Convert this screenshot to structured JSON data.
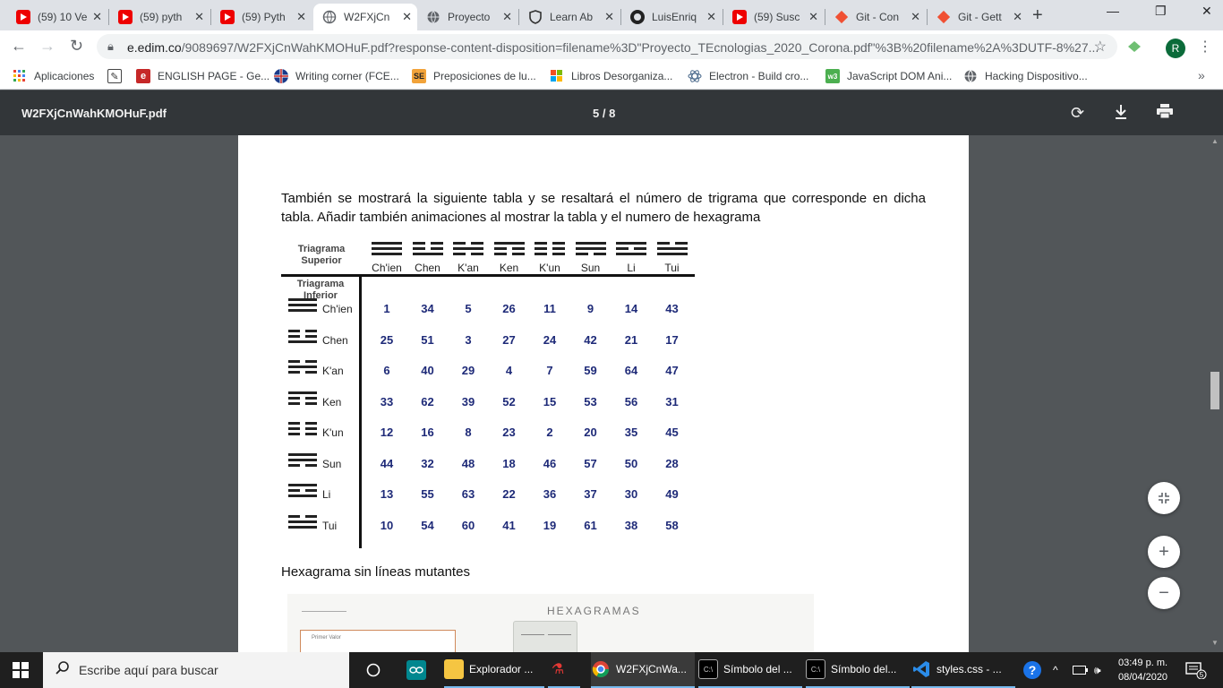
{
  "browser": {
    "tabs": [
      {
        "title": "(59) 10 Ve",
        "icon": "youtube-icon",
        "active": false
      },
      {
        "title": "(59) pyth",
        "icon": "youtube-icon",
        "active": false
      },
      {
        "title": "(59) Pyth",
        "icon": "youtube-icon",
        "active": false
      },
      {
        "title": "W2FXjCn",
        "icon": "globe-icon",
        "active": true
      },
      {
        "title": "Proyecto",
        "icon": "globe-icon",
        "active": false
      },
      {
        "title": "Learn Ab",
        "icon": "shield-icon",
        "active": false
      },
      {
        "title": "LuisEnriq",
        "icon": "github-icon",
        "active": false
      },
      {
        "title": "(59) Susc",
        "icon": "youtube-icon",
        "active": false
      },
      {
        "title": "Git - Con",
        "icon": "git-icon",
        "active": false
      },
      {
        "title": "Git - Gett",
        "icon": "git-icon",
        "active": false
      }
    ],
    "url_host": "e.edim.co",
    "url_path": "/9089697/W2FXjCnWahKMOHuF.pdf?response-content-disposition=filename%3D\"Proyecto_TEcnologias_2020_Corona.pdf\"%3B%20filename%2A%3DUTF-8%27...",
    "profile_initial": "R",
    "bookmarks": [
      {
        "label": "Aplicaciones",
        "icon": "apps-grid-icon"
      },
      {
        "label": "",
        "icon": "bookmark-favicon-icon"
      },
      {
        "label": "ENGLISH PAGE - Ge...",
        "icon": "english-page-icon"
      },
      {
        "label": "Writing corner (FCE...",
        "icon": "uk-flag-icon"
      },
      {
        "label": "Preposiciones de lu...",
        "icon": "se-icon"
      },
      {
        "label": "Libros Desorganiza...",
        "icon": "windows-logo-icon"
      },
      {
        "label": "Electron - Build cro...",
        "icon": "electron-icon"
      },
      {
        "label": "JavaScript DOM Ani...",
        "icon": "w3-icon"
      },
      {
        "label": "Hacking Dispositivo...",
        "icon": "globe-icon"
      }
    ]
  },
  "pdf": {
    "filename": "W2FXjCnWahKMOHuF.pdf",
    "page_indicator": "5 / 8",
    "paragraph": "También se mostrará  la siguiente tabla y se resaltará el número de trigrama que corresponde en dicha tabla. Añadir también animaciones al mostrar la tabla y el numero de hexagrama",
    "table": {
      "header_superior": "Triagrama Superior",
      "header_inferior": "Triagrama Inferior",
      "columns": [
        "Ch'ien",
        "Chen",
        "K'an",
        "Ken",
        "K'un",
        "Sun",
        "Li",
        "Tui"
      ],
      "rows": [
        {
          "name": "Ch'ien",
          "values": [
            "1",
            "34",
            "5",
            "26",
            "11",
            "9",
            "14",
            "43"
          ]
        },
        {
          "name": "Chen",
          "values": [
            "25",
            "51",
            "3",
            "27",
            "24",
            "42",
            "21",
            "17"
          ]
        },
        {
          "name": "K'an",
          "values": [
            "6",
            "40",
            "29",
            "4",
            "7",
            "59",
            "64",
            "47"
          ]
        },
        {
          "name": "Ken",
          "values": [
            "33",
            "62",
            "39",
            "52",
            "15",
            "53",
            "56",
            "31"
          ]
        },
        {
          "name": "K'un",
          "values": [
            "12",
            "16",
            "8",
            "23",
            "2",
            "20",
            "35",
            "45"
          ]
        },
        {
          "name": "Sun",
          "values": [
            "44",
            "32",
            "48",
            "18",
            "46",
            "57",
            "50",
            "28"
          ]
        },
        {
          "name": "Li",
          "values": [
            "13",
            "55",
            "63",
            "22",
            "36",
            "37",
            "30",
            "49"
          ]
        },
        {
          "name": "Tui",
          "values": [
            "10",
            "54",
            "60",
            "41",
            "19",
            "61",
            "38",
            "58"
          ]
        }
      ]
    },
    "subheading": "Hexagrama sin líneas mutantes",
    "figure_title": "HEXAGRAMAS",
    "figure_input_label": "Primer Valor"
  },
  "taskbar": {
    "search_placeholder": "Escribe aquí para buscar",
    "items": [
      {
        "label": "",
        "icon": "task-view-icon"
      },
      {
        "label": "",
        "icon": "arduino-icon"
      },
      {
        "label": "Explorador ...",
        "icon": "file-explorer-icon"
      },
      {
        "label": "",
        "icon": "app-icon"
      },
      {
        "label": "W2FXjCnWa...",
        "icon": "chrome-icon"
      },
      {
        "label": "Símbolo del ...",
        "icon": "terminal-icon"
      },
      {
        "label": "Símbolo del...",
        "icon": "terminal-icon"
      },
      {
        "label": "styles.css - ...",
        "icon": "vscode-icon"
      }
    ],
    "time": "03:49 p. m.",
    "date": "08/04/2020",
    "notification_count": "5"
  }
}
